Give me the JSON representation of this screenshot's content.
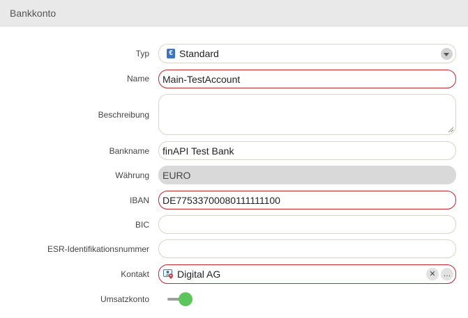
{
  "panel": {
    "title": "Bankkonto"
  },
  "form": {
    "type": {
      "label": "Typ",
      "value": "Standard",
      "icon": "euro-icon"
    },
    "name": {
      "label": "Name",
      "value": "Main-TestAccount"
    },
    "description": {
      "label": "Beschreibung",
      "value": ""
    },
    "bankname": {
      "label": "Bankname",
      "value": "finAPI Test Bank"
    },
    "currency": {
      "label": "Währung",
      "value": "EURO"
    },
    "iban": {
      "label": "IBAN",
      "value": "DE77533700080111111100"
    },
    "bic": {
      "label": "BIC",
      "value": ""
    },
    "esr": {
      "label": "ESR-Identifikationsnummer",
      "value": ""
    },
    "contact": {
      "label": "Kontakt",
      "value": "Digital AG",
      "clear_glyph": "✕",
      "more_glyph": "…"
    },
    "turnover": {
      "label": "Umsatzkonto",
      "enabled": true
    }
  },
  "colors": {
    "required_border": "#c0262d",
    "toggle_on": "#5cc65c",
    "header_bg": "#e9e9e9"
  }
}
